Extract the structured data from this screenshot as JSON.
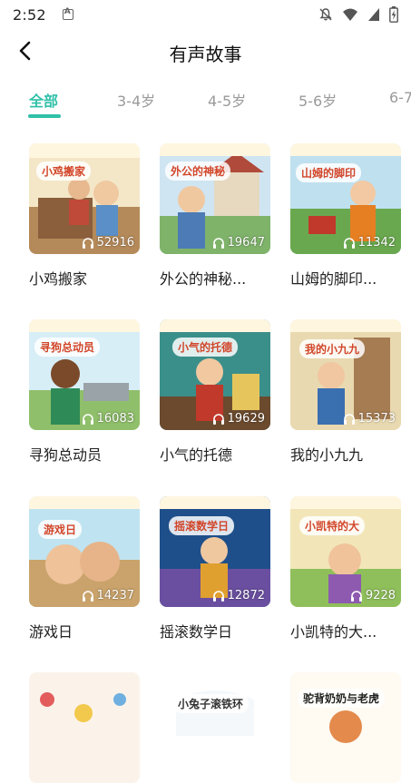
{
  "status": {
    "time": "2:52"
  },
  "header": {
    "title": "有声故事"
  },
  "tabs": [
    {
      "label": "全部",
      "active": true
    },
    {
      "label": "3-4岁",
      "active": false
    },
    {
      "label": "4-5岁",
      "active": false
    },
    {
      "label": "5-6岁",
      "active": false
    },
    {
      "label": "6-7",
      "active": false
    }
  ],
  "books": [
    {
      "title": "小鸡搬家",
      "cover_text": "小鸡搬家",
      "plays": "52916"
    },
    {
      "title": "外公的神秘...",
      "cover_text": "外公的神秘",
      "plays": "19647"
    },
    {
      "title": "山姆的脚印...",
      "cover_text": "山姆的脚印",
      "plays": "11342"
    },
    {
      "title": "寻狗总动员",
      "cover_text": "寻狗总动员",
      "plays": "16083"
    },
    {
      "title": "小气的托德",
      "cover_text": "小气的托德",
      "plays": "19629"
    },
    {
      "title": "我的小九九",
      "cover_text": "我的小九九",
      "plays": "15373"
    },
    {
      "title": "游戏日",
      "cover_text": "游戏日",
      "plays": "14237"
    },
    {
      "title": "摇滚数学日",
      "cover_text": "摇滚数学日",
      "plays": "12872"
    },
    {
      "title": "小凯特的大...",
      "cover_text": "小凯特的大",
      "plays": "9228"
    },
    {
      "title": "",
      "cover_text": "",
      "plays": ""
    },
    {
      "title": "",
      "cover_text": "小兔子滚铁环",
      "plays": ""
    },
    {
      "title": "",
      "cover_text": "驼背奶奶与老虎",
      "plays": ""
    }
  ],
  "colors": {
    "accent": "#2fc0a8",
    "tab_inactive": "#9a9a9a"
  }
}
